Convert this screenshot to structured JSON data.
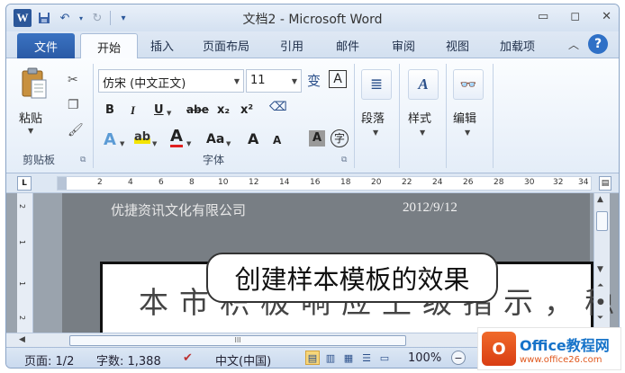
{
  "app": {
    "window_title": "文档2 - Microsoft Word",
    "logo_letter": "W"
  },
  "qat": {
    "save_icon": "save-icon",
    "undo_icon": "undo-icon",
    "redo_icon": "redo-icon"
  },
  "tabs": {
    "file": "文件",
    "home": "开始",
    "insert": "插入",
    "page_layout": "页面布局",
    "references": "引用",
    "mailings": "邮件",
    "review": "审阅",
    "view": "视图",
    "addins": "加载项"
  },
  "ribbon": {
    "clipboard": {
      "paste_label": "粘贴",
      "group_label": "剪贴板"
    },
    "font": {
      "font_name": "仿宋 (中文正文)",
      "font_size": "11",
      "group_label": "字体",
      "bold": "B",
      "italic": "I",
      "underline": "U",
      "strike": "abe",
      "subscript": "x₂",
      "superscript": "x²",
      "change_case": "Aa",
      "grow": "A",
      "shrink": "A",
      "char_border": "A",
      "char_shading": "A",
      "enclose": "字",
      "phonetic": "变"
    },
    "paragraph": {
      "label": "段落"
    },
    "styles": {
      "label": "样式"
    },
    "editing": {
      "label": "编辑"
    }
  },
  "ruler": {
    "corner": "L",
    "ticks": [
      "2",
      "4",
      "6",
      "8",
      "10",
      "12",
      "14",
      "16",
      "18",
      "20",
      "22",
      "24",
      "26",
      "28",
      "30",
      "32",
      "34"
    ],
    "vticks": [
      "2",
      "1",
      "1",
      "2"
    ]
  },
  "document": {
    "header_company": "优捷资讯文化有限公司",
    "header_date": "2012/9/12",
    "body_text": "本市积极响应上级指示，稳步",
    "callout": "创建样本模板的效果"
  },
  "status": {
    "page": "页面: 1/2",
    "words": "字数: 1,388",
    "language": "中文(中国)",
    "zoom": "100%"
  },
  "watermark": {
    "title": "Office教程网",
    "url": "www.office26.com"
  },
  "colors": {
    "file_tab": "#2a5aa6",
    "accent": "#2b579a",
    "highlight": "#f7d67a"
  }
}
